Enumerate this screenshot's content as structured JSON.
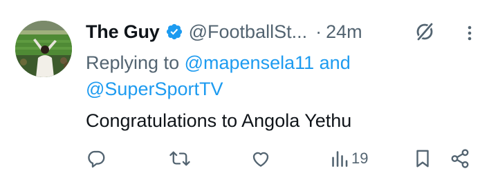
{
  "tweet": {
    "display_name": "The Guy",
    "handle": "@FootballSt...",
    "separator": "·",
    "time": "24m",
    "replying_prefix": "Replying to",
    "mention_1": "@mapensela11",
    "conjunction": "and",
    "mention_2": "@SuperSportTV",
    "body": "Congratulations to Angola Yethu"
  },
  "actions": {
    "views_count": "19"
  },
  "colors": {
    "text": "#0f1419",
    "muted": "#536471",
    "accent": "#1d9bf0",
    "verified": "#1d9bf0"
  },
  "icons": {
    "verified": "verified-badge-icon",
    "grok": "grok-icon",
    "more": "more-vertical-icon",
    "reply": "reply-icon",
    "retweet": "retweet-icon",
    "like": "heart-icon",
    "views": "views-icon",
    "bookmark": "bookmark-icon",
    "share": "share-icon"
  }
}
